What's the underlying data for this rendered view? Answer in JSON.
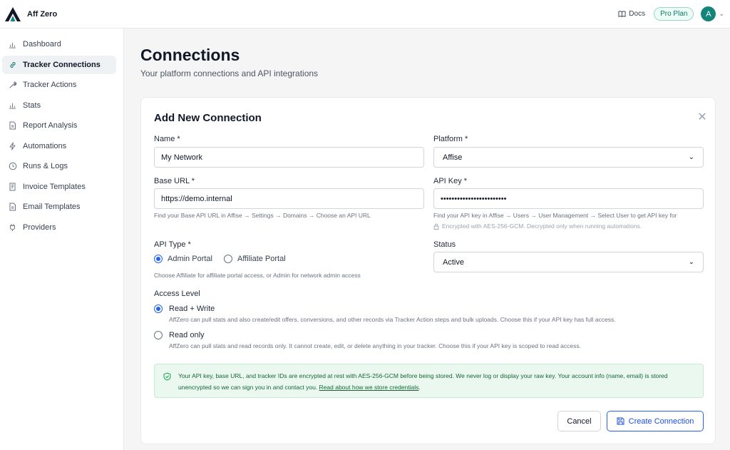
{
  "app": {
    "name": "Aff Zero"
  },
  "topbar": {
    "docs_label": "Docs",
    "plan_label": "Pro Plan",
    "avatar_initial": "A"
  },
  "sidebar": {
    "items": [
      {
        "label": "Dashboard",
        "icon": "bar-chart-icon"
      },
      {
        "label": "Tracker Connections",
        "icon": "link-icon",
        "active": true
      },
      {
        "label": "Tracker Actions",
        "icon": "wrench-icon"
      },
      {
        "label": "Stats",
        "icon": "bar-chart-icon"
      },
      {
        "label": "Report Analysis",
        "icon": "document-icon"
      },
      {
        "label": "Automations",
        "icon": "lightning-icon"
      },
      {
        "label": "Runs & Logs",
        "icon": "clock-icon"
      },
      {
        "label": "Invoice Templates",
        "icon": "receipt-icon"
      },
      {
        "label": "Email Templates",
        "icon": "document-icon"
      },
      {
        "label": "Providers",
        "icon": "plug-icon"
      }
    ]
  },
  "page": {
    "title": "Connections",
    "subtitle": "Your platform connections and API integrations"
  },
  "form": {
    "title": "Add New Connection",
    "name": {
      "label": "Name *",
      "value": "My Network"
    },
    "platform": {
      "label": "Platform *",
      "value": "Affise"
    },
    "base_url": {
      "label": "Base URL *",
      "value": "https://demo.internal",
      "hint": "Find your Base API URL in Affise → Settings → Domains → Choose an API URL"
    },
    "api_key": {
      "label": "API Key *",
      "value": "••••••••••••••••••••••••",
      "hint": "Find your API key in Affise → Users → User Management → Select User to get API key for",
      "encryption_note": "Encrypted with AES-256-GCM. Decrypted only when running automations."
    },
    "api_type": {
      "label": "API Type *",
      "options": [
        "Admin Portal",
        "Affiliate Portal"
      ],
      "selected": "Admin Portal",
      "hint": "Choose Affiliate for affiliate portal access, or Admin for network admin access"
    },
    "status": {
      "label": "Status",
      "value": "Active"
    },
    "access_level": {
      "label": "Access Level",
      "options": [
        {
          "title": "Read + Write",
          "desc": "AffZero can pull stats and also create/edit offers, conversions, and other records via Tracker Action steps and bulk uploads. Choose this if your API key has full access.",
          "checked": true
        },
        {
          "title": "Read only",
          "desc": "AffZero can pull stats and read records only. It cannot create, edit, or delete anything in your tracker. Choose this if your API key is scoped to read access.",
          "checked": false
        }
      ]
    },
    "notice": {
      "text": "Your API key, base URL, and tracker IDs are encrypted at rest with AES-256-GCM before being stored. We never log or display your raw key. Your account info (name, email) is stored unencrypted so we can sign you in and contact you.",
      "link": "Read about how we store credentials",
      "after_link": "."
    },
    "cancel_label": "Cancel",
    "create_label": "Create Connection"
  }
}
